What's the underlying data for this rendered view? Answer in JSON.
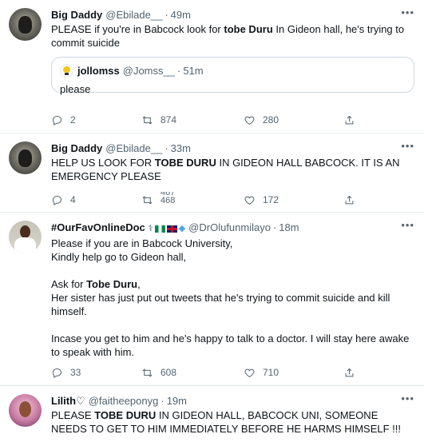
{
  "tweets": [
    {
      "name": "Big Daddy",
      "handle": "@Ebilade__",
      "separator": "·",
      "time": "49m",
      "text_before": "PLEASE if you're in Babcock look for ",
      "text_bold": "tobe Duru",
      "text_after": " In Gideon hall, he's trying to commit suicide",
      "quote": {
        "name": "jollomss",
        "handle": "@Jomss__",
        "separator": "·",
        "time": "51m",
        "text": "please"
      },
      "replies": "2",
      "retweets": "874",
      "likes": "280"
    },
    {
      "name": "Big Daddy",
      "handle": "@Ebilade__",
      "separator": "·",
      "time": "33m",
      "text_before": "HELP US LOOK FOR ",
      "text_bold": "TOBE DURU",
      "text_after": " IN GIDEON HALL BABCOCK. IT IS AN EMERGENCY PLEASE",
      "replies": "4",
      "retweets_top": "467",
      "retweets_bottom": "468",
      "likes": "172"
    },
    {
      "name": "#OurFavOnlineDoc",
      "handle": "@DrOlufunmilayo",
      "separator": "·",
      "time": "18m",
      "line1": "Please if you are in Babcock University,",
      "line2": "Kindly help go to Gideon hall,",
      "line3_before": "Ask for ",
      "line3_bold": "Tobe Duru",
      "line3_after": ",",
      "line4": "Her sister has just put out tweets that he's trying to commit suicide and kill himself.",
      "line5": "Incase you get to him and he's happy to talk to a doctor. I will stay here awake to speak with him.",
      "replies": "33",
      "retweets": "608",
      "likes": "710"
    },
    {
      "name": "Lilith♡",
      "handle": "@faitheeponyg",
      "separator": "·",
      "time": "19m",
      "text_before": "PLEASE ",
      "text_bold": "TOBE DURU",
      "text_after": " IN GIDEON HALL, BABCOCK UNI, SOMEONE NEEDS TO GET TO HIM IMMEDIATELY BEFORE HE HARMS HIMSELF !!!"
    }
  ],
  "more_label": "•••",
  "doc_badges": {
    "stethoscope": "stethoscope-icon",
    "flags": [
      "nigeria-flag",
      "uk-flag"
    ],
    "gem": "gem-icon"
  },
  "colors": {
    "text": "#0f1419",
    "secondary": "#536471",
    "divider": "#e6ecf0"
  }
}
